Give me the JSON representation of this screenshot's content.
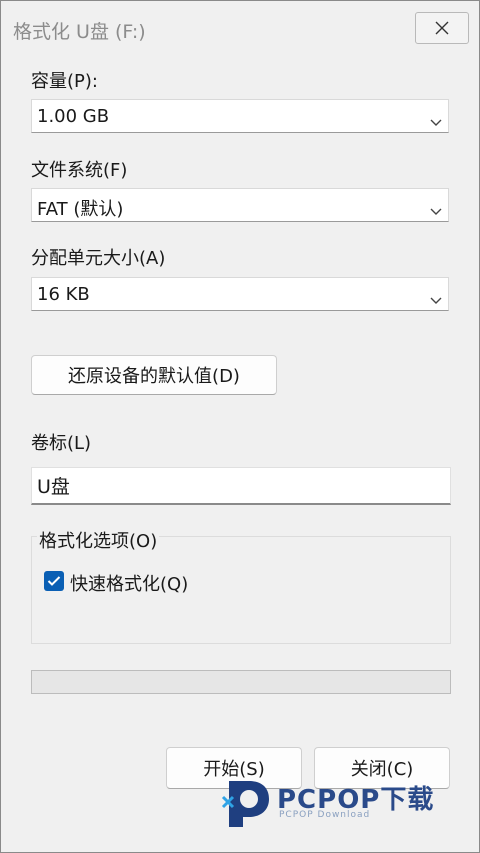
{
  "window": {
    "title": "格式化 U盘 (F:)"
  },
  "icons": {
    "close": "close-icon",
    "dropdown": "chevron-down-icon",
    "check": "checkmark-icon"
  },
  "capacity": {
    "label": "容量(P):",
    "value": "1.00 GB"
  },
  "filesystem": {
    "label": "文件系统(F)",
    "value": "FAT (默认)"
  },
  "allocation": {
    "label": "分配单元大小(A)",
    "value": "16 KB"
  },
  "restore_button": {
    "label": "还原设备的默认值(D)"
  },
  "volume_label": {
    "label": "卷标(L)",
    "value": "U盘"
  },
  "format_options": {
    "title": "格式化选项(O)",
    "quick_format": {
      "label": "快速格式化(Q)",
      "checked": true
    }
  },
  "progress": {
    "value": 0
  },
  "buttons": {
    "start": "开始(S)",
    "close": "关闭(C)"
  },
  "watermark": {
    "brand": "PCPOP下载",
    "sub": "PCPOP Download"
  },
  "colors": {
    "accent": "#0a5fb4",
    "background": "#f0f0f0",
    "title_text": "#8c8c8c"
  }
}
